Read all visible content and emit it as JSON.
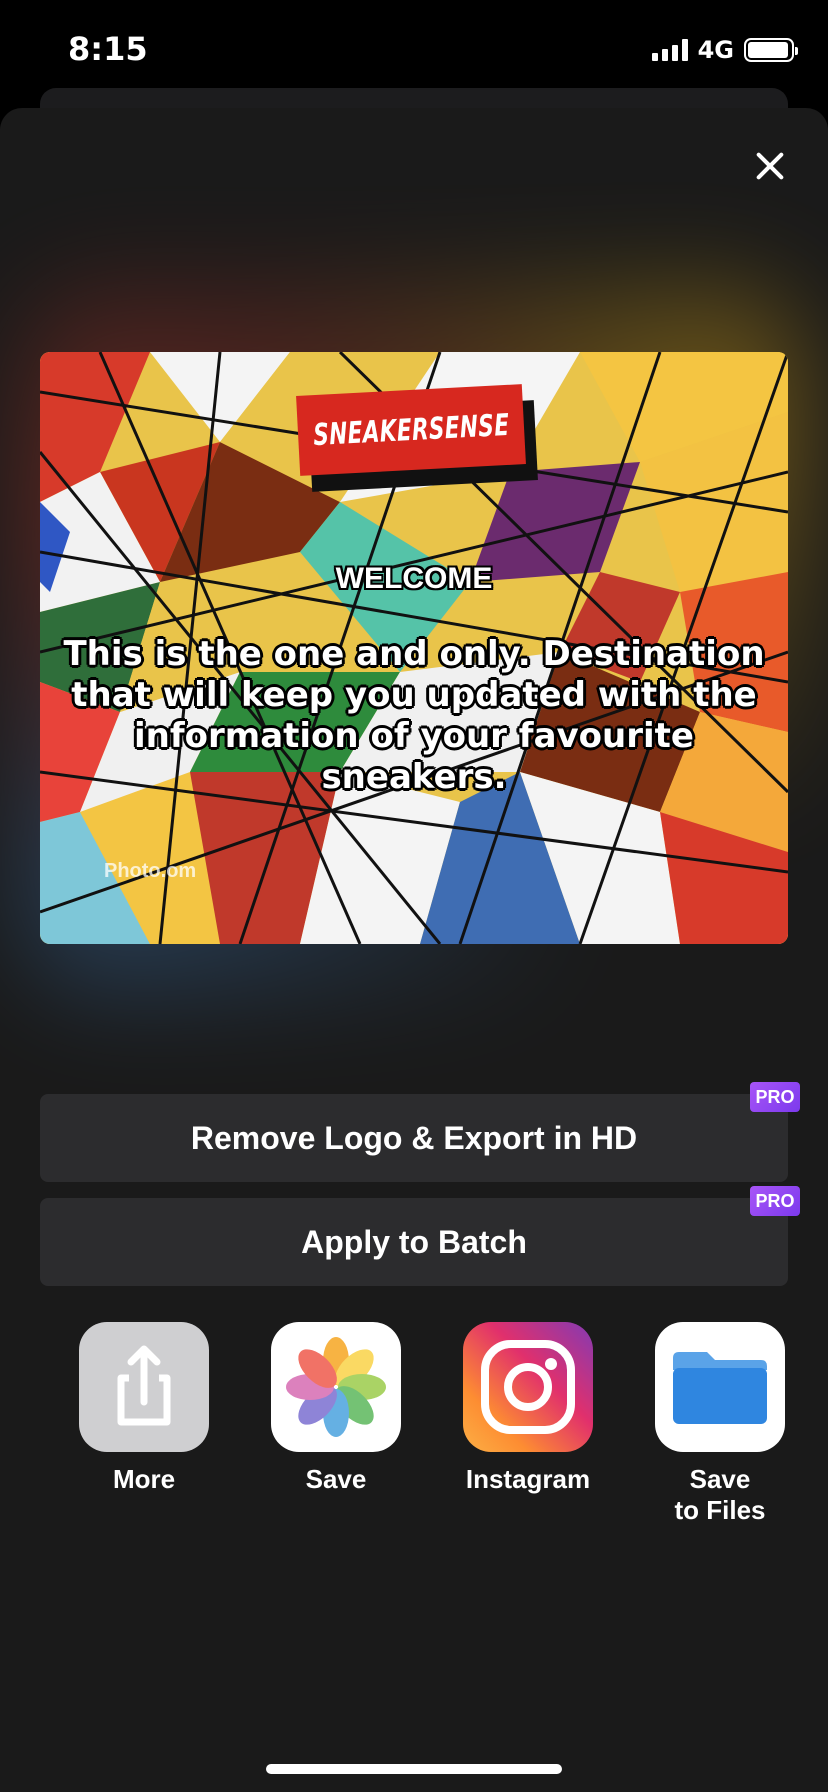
{
  "status_bar": {
    "time": "8:15",
    "network": "4G",
    "battery_level": 0.95
  },
  "preview": {
    "logo_text": "SNEAKERSENSE",
    "welcome": "WELCOME",
    "message": "This is the one and only. Destination that will keep you updated with the information of your favourite sneakers.",
    "watermark": "Photo.om"
  },
  "actions": {
    "remove_logo_label": "Remove Logo & Export in HD",
    "apply_batch_label": "Apply to Batch",
    "pro_badge": "PRO"
  },
  "share_targets": [
    {
      "label": "More",
      "icon": "share-icon"
    },
    {
      "label": "Save",
      "icon": "photos-icon"
    },
    {
      "label": "Instagram",
      "icon": "instagram-icon"
    },
    {
      "label": "Save\nto Files",
      "icon": "files-icon"
    }
  ],
  "colors": {
    "sheet_bg": "#1a1a1a",
    "button_bg": "#2c2c2e",
    "pro_badge": "#9b4dff",
    "logo_red": "#d7281f"
  }
}
